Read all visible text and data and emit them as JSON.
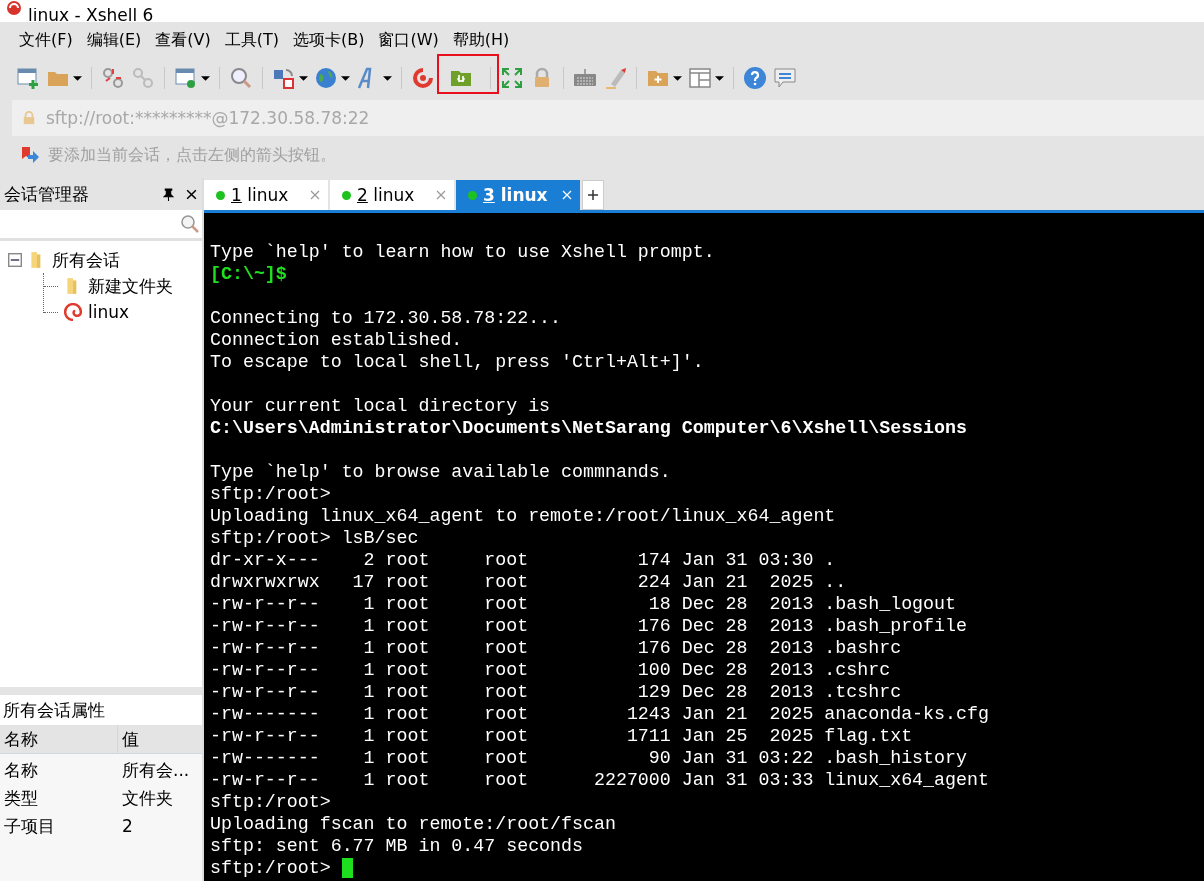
{
  "window": {
    "title": "linux - Xshell 6"
  },
  "menu": [
    "文件(F)",
    "编辑(E)",
    "查看(V)",
    "工具(T)",
    "选项卡(B)",
    "窗口(W)",
    "帮助(H)"
  ],
  "address": {
    "value": "sftp://root:*********@172.30.58.78:22"
  },
  "hint": "要添加当前会话，点击左侧的箭头按钮。",
  "session_manager": {
    "title": "会话管理器",
    "tree": [
      {
        "label": "所有会话",
        "kind": "folder",
        "expanded": true,
        "children": [
          {
            "label": "新建文件夹",
            "kind": "folder"
          },
          {
            "label": "linux",
            "kind": "session"
          }
        ]
      }
    ]
  },
  "properties": {
    "title": "所有会话属性",
    "columns": [
      "名称",
      "值"
    ],
    "rows": [
      [
        "名称",
        "所有会..."
      ],
      [
        "类型",
        "文件夹"
      ],
      [
        "子项目",
        "2"
      ]
    ]
  },
  "tabs": [
    {
      "number": "1",
      "label": "linux",
      "selected": false
    },
    {
      "number": "2",
      "label": "linux",
      "selected": false
    },
    {
      "number": "3",
      "label": "linux",
      "selected": true
    }
  ],
  "terminal": [
    {
      "kind": "blank"
    },
    {
      "kind": "text",
      "text": "Type `help' to learn how to use Xshell prompt."
    },
    {
      "kind": "prompt",
      "text": "[C:\\~]$"
    },
    {
      "kind": "blank"
    },
    {
      "kind": "text",
      "text": "Connecting to 172.30.58.78:22..."
    },
    {
      "kind": "text",
      "text": "Connection established."
    },
    {
      "kind": "text",
      "text": "To escape to local shell, press 'Ctrl+Alt+]'."
    },
    {
      "kind": "blank"
    },
    {
      "kind": "text",
      "text": "Your current local directory is"
    },
    {
      "kind": "bold",
      "text": "C:\\Users\\Administrator\\Documents\\NetSarang Computer\\6\\Xshell\\Sessions"
    },
    {
      "kind": "blank"
    },
    {
      "kind": "text",
      "text": "Type `help' to browse available commnands."
    },
    {
      "kind": "text",
      "text": "sftp:/root>"
    },
    {
      "kind": "text",
      "text": "Uploading linux_x64_agent to remote:/root/linux_x64_agent"
    },
    {
      "kind": "text",
      "text": "sftp:/root> lsB/sec"
    },
    {
      "kind": "text",
      "text": "dr-xr-x---    2 root     root          174 Jan 31 03:30 ."
    },
    {
      "kind": "text",
      "text": "drwxrwxrwx   17 root     root          224 Jan 21  2025 .."
    },
    {
      "kind": "text",
      "text": "-rw-r--r--    1 root     root           18 Dec 28  2013 .bash_logout"
    },
    {
      "kind": "text",
      "text": "-rw-r--r--    1 root     root          176 Dec 28  2013 .bash_profile"
    },
    {
      "kind": "text",
      "text": "-rw-r--r--    1 root     root          176 Dec 28  2013 .bashrc"
    },
    {
      "kind": "text",
      "text": "-rw-r--r--    1 root     root          100 Dec 28  2013 .cshrc"
    },
    {
      "kind": "text",
      "text": "-rw-r--r--    1 root     root          129 Dec 28  2013 .tcshrc"
    },
    {
      "kind": "text",
      "text": "-rw-------    1 root     root         1243 Jan 21  2025 anaconda-ks.cfg"
    },
    {
      "kind": "text",
      "text": "-rw-r--r--    1 root     root         1711 Jan 25  2025 flag.txt"
    },
    {
      "kind": "text",
      "text": "-rw-------    1 root     root           90 Jan 31 03:22 .bash_history"
    },
    {
      "kind": "text",
      "text": "-rw-r--r--    1 root     root      2227000 Jan 31 03:33 linux_x64_agent"
    },
    {
      "kind": "text",
      "text": "sftp:/root>"
    },
    {
      "kind": "text",
      "text": "Uploading fscan to remote:/root/fscan"
    },
    {
      "kind": "text",
      "text": "sftp: sent 6.77 MB in 0.47 seconds"
    },
    {
      "kind": "text",
      "text": "sftp:/root> ",
      "cursor": true
    }
  ]
}
